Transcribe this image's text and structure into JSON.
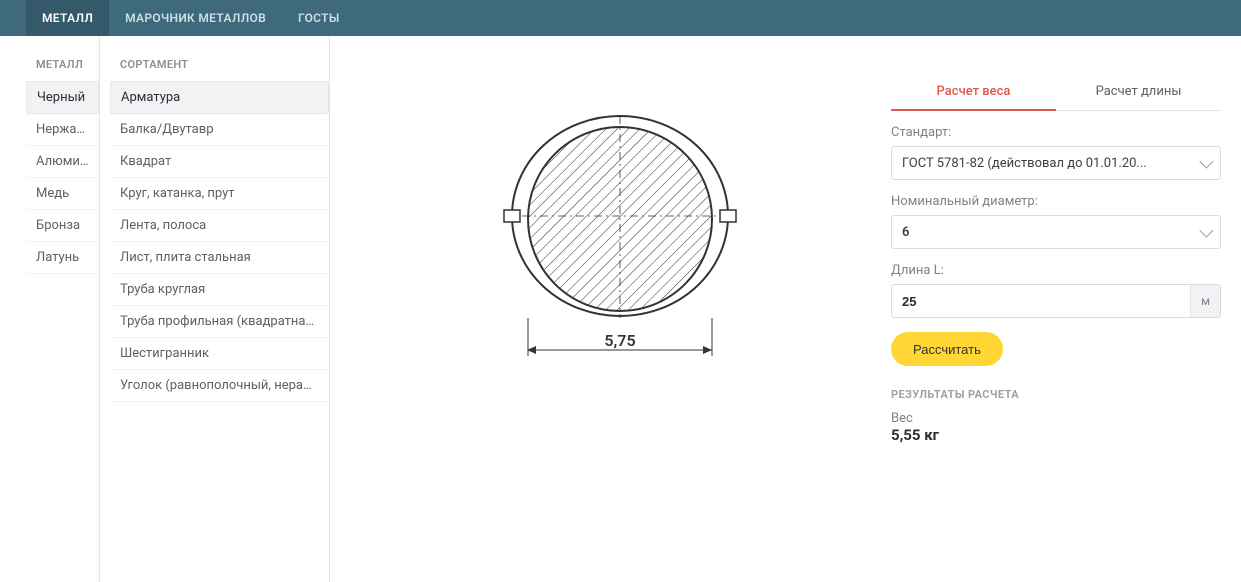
{
  "topnav": {
    "items": [
      {
        "label": "МЕТАЛЛ",
        "active": true
      },
      {
        "label": "МАРОЧНИК МЕТАЛЛОВ"
      },
      {
        "label": "ГОСТЫ"
      }
    ]
  },
  "metal_column": {
    "heading": "МЕТАЛЛ",
    "items": [
      {
        "label": "Черный",
        "selected": true
      },
      {
        "label": "Нержавейка"
      },
      {
        "label": "Алюминий"
      },
      {
        "label": "Медь"
      },
      {
        "label": "Бронза"
      },
      {
        "label": "Латунь"
      }
    ]
  },
  "sort_column": {
    "heading": "СОРТАМЕНТ",
    "items": [
      {
        "label": "Арматура",
        "selected": true
      },
      {
        "label": "Балка/Двутавр"
      },
      {
        "label": "Квадрат"
      },
      {
        "label": "Круг, катанка, прут"
      },
      {
        "label": "Лента, полоса"
      },
      {
        "label": "Лист, плита стальная"
      },
      {
        "label": "Труба круглая"
      },
      {
        "label": "Труба профильная (квадратная /..."
      },
      {
        "label": "Шестигранник"
      },
      {
        "label": "Уголок (равнополочный, неравн..."
      }
    ]
  },
  "diagram": {
    "dimension_label": "5,75"
  },
  "panel": {
    "tabs": [
      {
        "label": "Расчет веса",
        "active": true
      },
      {
        "label": "Расчет длины"
      }
    ],
    "standard": {
      "label": "Стандарт:",
      "value": "ГОСТ 5781-82 (действовал до 01.01.20..."
    },
    "diameter": {
      "label": "Номинальный диаметр:",
      "value": "6"
    },
    "length": {
      "label": "Длина L:",
      "value": "25",
      "unit": "м"
    },
    "calc_button": "Рассчитать",
    "results": {
      "heading": "РЕЗУЛЬТАТЫ РАСЧЕТА",
      "weight_label": "Вес",
      "weight_value": "5,55 кг"
    }
  }
}
